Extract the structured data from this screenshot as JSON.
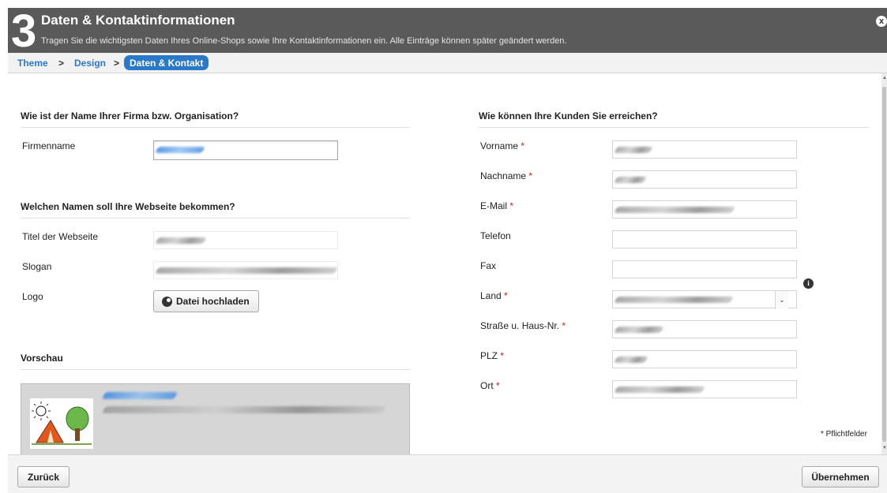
{
  "header": {
    "step_number": "3",
    "title": "Daten & Kontaktinformationen",
    "subtitle": "Tragen Sie die wichtigsten Daten Ihres Online-Shops sowie Ihre Kontaktinformationen ein. Alle Einträge können später geändert werden.",
    "close_label": "x"
  },
  "breadcrumb": {
    "items": [
      "Theme",
      "Design"
    ],
    "separator": ">",
    "active": "Daten & Kontakt"
  },
  "left": {
    "company_section_title": "Wie ist der Name Ihrer Firma bzw. Organisation?",
    "company_label": "Firmenname",
    "website_section_title": "Welchen Namen soll Ihre Webseite bekommen?",
    "site_title_label": "Titel der Webseite",
    "slogan_label": "Slogan",
    "logo_label": "Logo",
    "upload_button": "Datei hochladen",
    "preview_section_title": "Vorschau"
  },
  "right": {
    "section_title": "Wie können Ihre Kunden Sie erreichen?",
    "fields": [
      {
        "label": "Vorname",
        "required": "*"
      },
      {
        "label": "Nachname",
        "required": "*"
      },
      {
        "label": "E-Mail",
        "required": "*"
      },
      {
        "label": "Telefon",
        "required": ""
      },
      {
        "label": "Fax",
        "required": ""
      },
      {
        "label": "Land",
        "required": "*"
      },
      {
        "label": "Straße u. Haus-Nr.",
        "required": "*"
      },
      {
        "label": "PLZ",
        "required": "*"
      },
      {
        "label": "Ort",
        "required": "*"
      }
    ],
    "info_icon": "i",
    "select_arrow": "⌄",
    "required_note": "* Pflichtfelder"
  },
  "footer": {
    "back_button": "Zurück",
    "apply_button": "Übernehmen"
  },
  "colors": {
    "header_bg": "#5a5a5a",
    "accent_blue": "#2a78c8",
    "required_red": "#d01818"
  },
  "icons": [
    "close-icon",
    "upload-icon",
    "info-icon",
    "chevron-down-icon"
  ]
}
